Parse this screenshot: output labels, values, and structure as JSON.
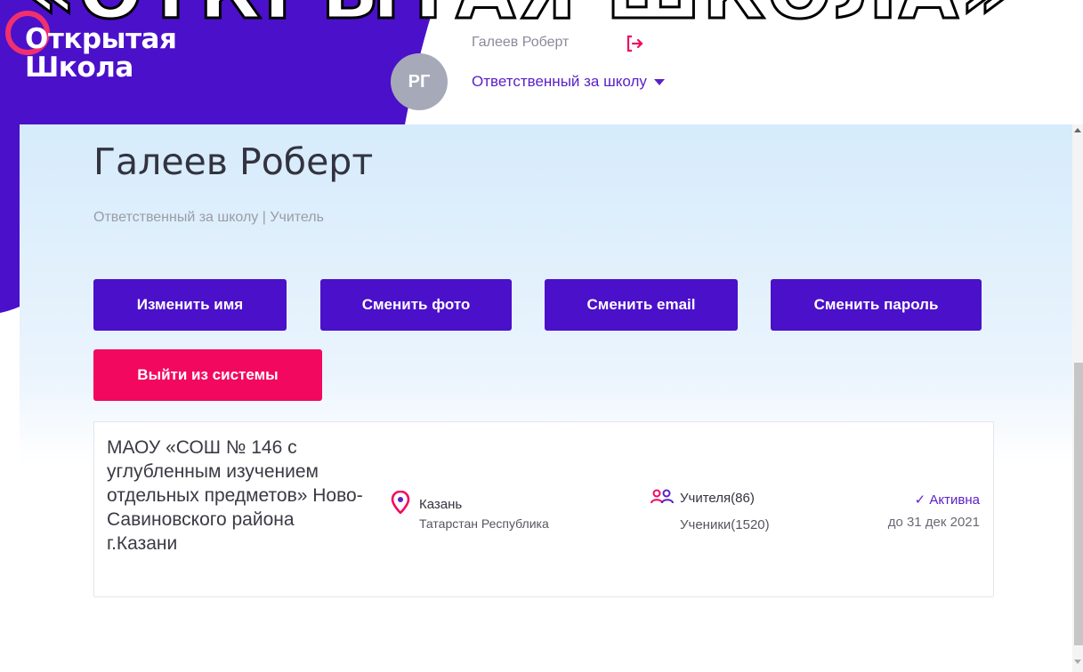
{
  "banner": {
    "text": "«ОТКРЫТАЯ ШКОЛА»"
  },
  "logo": {
    "line1": "Открытая",
    "line2": "Школа"
  },
  "header": {
    "avatar_initials": "РГ",
    "user_name": "Галеев Роберт",
    "role": "Ответственный за школу",
    "logout_icon": "logout-arrow-icon"
  },
  "profile": {
    "name": "Галеев Роберт",
    "roles": "Ответственный за школу | Учитель"
  },
  "actions": {
    "change_name": "Изменить имя",
    "change_photo": "Сменить фото",
    "change_email": "Сменить email",
    "change_password": "Сменить пароль",
    "logout": "Выйти из системы"
  },
  "school": {
    "name": "МАОУ «СОШ № 146 с углубленным изучением отдельных предметов» Ново-Савиновского района г.Казани",
    "city": "Казань",
    "region": "Татарстан Республика",
    "teachers": "Учителя(86)",
    "students": "Ученики(1520)",
    "status": "✓ Активна",
    "status_until": "до 31 дек 2021"
  },
  "colors": {
    "brand_purple": "#4b10c9",
    "accent_pink": "#f2085f",
    "link_purple": "#5a21c7"
  }
}
